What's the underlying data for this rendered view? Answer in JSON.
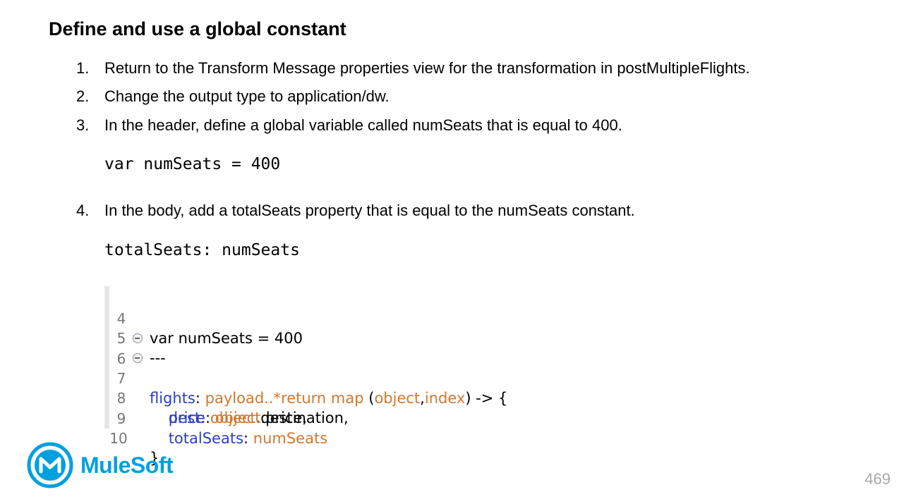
{
  "title": "Define and use a global constant",
  "steps": [
    {
      "num": "1.",
      "text": "Return to the Transform Message properties view for the transformation in postMultipleFlights."
    },
    {
      "num": "2.",
      "text": "Change the output type to application/dw."
    },
    {
      "num": "3.",
      "text": "In the header, define a global variable called numSeats that is equal to 400."
    },
    {
      "num": "4.",
      "text": "In the body, add a totalSeats property that is equal to the numSeats constant."
    }
  ],
  "code_snippets": {
    "header_var": "var numSeats = 400",
    "body_prop": "totalSeats: numSeats"
  },
  "editor": {
    "lines": [
      {
        "num": "4",
        "tokens": [
          "var numSeats = 400"
        ]
      },
      {
        "num": "5",
        "tokens": [
          "---"
        ]
      },
      {
        "num": "6",
        "tokens": [
          "flights",
          ": ",
          "payload..*",
          "return",
          " ",
          "map",
          " (",
          "object",
          ",",
          "index",
          ") -> {"
        ]
      },
      {
        "num": "7",
        "tokens": [
          "    dest",
          ": ",
          "object",
          ".destination,"
        ]
      },
      {
        "num": "8",
        "tokens": [
          "    price",
          ": ",
          "object",
          ".price,"
        ]
      },
      {
        "num": "9",
        "tokens": [
          "    totalSeats",
          ": ",
          "numSeats"
        ]
      },
      {
        "num": "10",
        "tokens": [
          "}"
        ]
      }
    ]
  },
  "footer": {
    "brand": "MuleSoft",
    "page_number": "469"
  },
  "colors": {
    "brand_blue": "#00a0df",
    "code_blue": "#2a3fc2",
    "code_orange": "#d1782f"
  },
  "icons": [
    "mulesoft-logo-icon",
    "fold-collapse-icon"
  ]
}
